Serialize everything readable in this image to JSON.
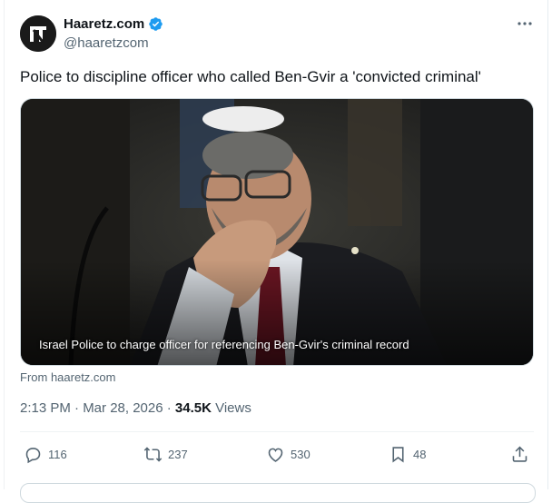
{
  "account": {
    "display_name": "Haaretz.com",
    "handle": "@haaretzcom",
    "verified_icon": "verified-badge-icon",
    "avatar_icon": "haaretz-logo-icon"
  },
  "tweet": {
    "text": "Police to discipline officer who called Ben-Gvir a 'convicted criminal'",
    "media_caption": "Israel Police to charge officer for referencing Ben-Gvir's criminal record",
    "source": "From haaretz.com",
    "timestamp": "2:13 PM · Mar 28, 2026 · ",
    "views_count": "34.5K",
    "views_label": " Views"
  },
  "actions": {
    "replies": "116",
    "reposts": "237",
    "likes": "530",
    "bookmarks": "48"
  },
  "colors": {
    "text": "#0f1419",
    "muted": "#536471",
    "verified": "#1d9bf0",
    "border": "#cfd9de"
  }
}
